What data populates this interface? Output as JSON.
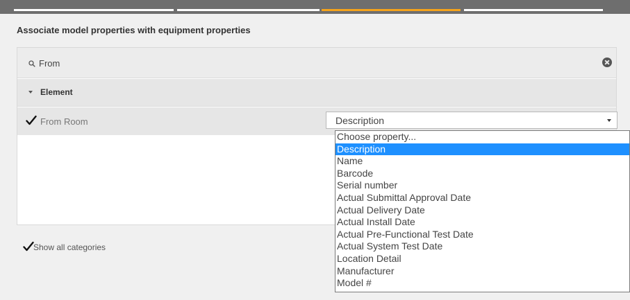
{
  "wizard": {
    "steps": [
      {
        "state": "done"
      },
      {
        "state": "done"
      },
      {
        "state": "active"
      },
      {
        "state": "pending"
      }
    ]
  },
  "heading": "Associate model properties with equipment properties",
  "search": {
    "value": "From"
  },
  "group": {
    "label": "Element"
  },
  "mapping": {
    "label": "From Room",
    "checked": true,
    "selected_value": "Description"
  },
  "dropdown": {
    "options": [
      "Choose property...",
      "Description",
      "Name",
      "Barcode",
      "Serial number",
      "Actual Submittal Approval Date",
      "Actual Delivery Date",
      "Actual Install Date",
      "Actual Pre-Functional Test Date",
      "Actual System Test Date",
      "Location Detail",
      "Manufacturer",
      "Model #"
    ],
    "selected_index": 1
  },
  "show_all": {
    "label": "Show all categories",
    "checked": true
  },
  "colors": {
    "accent": "#f5a31a",
    "selection": "#1e90ff",
    "topbar": "#6e6e6e"
  }
}
